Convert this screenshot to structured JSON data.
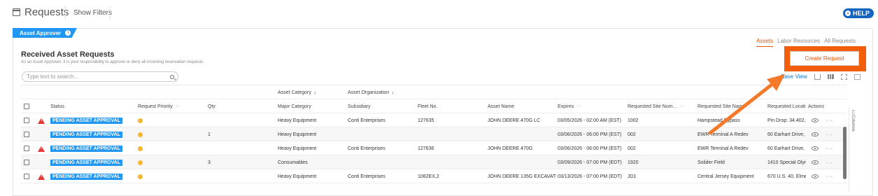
{
  "header": {
    "title": "Requests",
    "show_filters": "Show Filters",
    "help_label": "HELP"
  },
  "role_tab": {
    "label": "Asset Approver",
    "info_icon": "i"
  },
  "tabs": [
    {
      "label": "Assets",
      "active": true
    },
    {
      "label": "Labor Resources",
      "active": false
    },
    {
      "label": "All Requests",
      "active": false
    }
  ],
  "page": {
    "heading": "Received Asset Requests",
    "subheading": "As an Asset Approver, it is your responsibility to approve or deny all incoming reservation requests.",
    "create_button": "Create Request",
    "search_placeholder": "Type text to search...",
    "save_view": "Save View"
  },
  "grid": {
    "group_headers": {
      "asset_category": "Asset Category",
      "asset_organization": "Asset Organization"
    },
    "columns": {
      "status": "Status",
      "priority": "Request Priority",
      "qty": "Qty",
      "major_category": "Major Category",
      "subsidiary": "Subsidiary",
      "fleet_no": "Fleet No.",
      "asset_name": "Asset Name",
      "expires": "Expires",
      "site_num": "Requested Site Num...",
      "site_name": "Requested Site Name",
      "location": "Requested Locati",
      "actions": "Actions"
    },
    "side_label": "Columns",
    "rows": [
      {
        "warning": true,
        "status": "PENDING ASSET APPROVAL",
        "qty": "",
        "major_category": "Heavy Equipment",
        "subsidiary": "Conti Enterprises",
        "fleet_no": "127635",
        "asset_name": "JOHN DEERE 470G LC",
        "expires": "03/05/2026 - 02:00 AM (EST)",
        "site_num": "1002",
        "site_name": "Hampstead Bypass",
        "location": "Pin Drop: 34.402,-"
      },
      {
        "warning": false,
        "status": "PENDING ASSET APPROVAL",
        "qty": "1",
        "major_category": "Heavy Equipment",
        "subsidiary": "",
        "fleet_no": "",
        "asset_name": "",
        "expires": "03/06/2026 - 06:00 PM (EST)",
        "site_num": "002",
        "site_name": "EWR Terminal A Redev",
        "location": "60 Earhart Drive, I"
      },
      {
        "warning": true,
        "status": "PENDING ASSET APPROVAL",
        "qty": "",
        "major_category": "Heavy Equipment",
        "subsidiary": "Conti Enterprises",
        "fleet_no": "127636",
        "asset_name": "JOHN DEERE 470G",
        "expires": "03/06/2026 - 06:00 PM (EST)",
        "site_num": "002",
        "site_name": "EWR Terminal A Redev",
        "location": "60 Earhart Drive, I"
      },
      {
        "warning": false,
        "status": "PENDING ASSET APPROVAL",
        "qty": "3",
        "major_category": "Consumables",
        "subsidiary": "",
        "fleet_no": "",
        "asset_name": "",
        "expires": "03/09/2026 - 07:00 PM (EDT)",
        "site_num": "1920",
        "site_name": "Solider Field",
        "location": "1410 Special Olyn"
      },
      {
        "warning": true,
        "status": "PENDING ASSET APPROVAL",
        "qty": "",
        "major_category": "Heavy Equipment",
        "subsidiary": "Conti Enterprises",
        "fleet_no": "1082EX,2",
        "asset_name": "JOHN DEERE 135G EXCAVATC",
        "expires": "03/13/2026 - 07:00 PM (EDT)",
        "site_num": "JD1",
        "site_name": "Central Jersey Equipment",
        "location": "670 U.S. 40, Elme"
      }
    ]
  },
  "colors": {
    "accent_orange": "#f25e0c",
    "badge_blue": "#2196f3",
    "warning_red": "#e53935",
    "priority_yellow": "#f5b82e",
    "help_blue": "#1565c0"
  }
}
